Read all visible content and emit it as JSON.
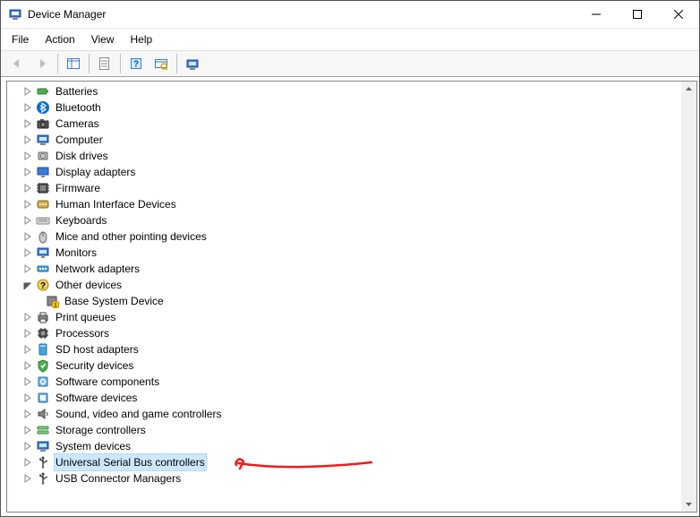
{
  "window": {
    "title": "Device Manager"
  },
  "menu": {
    "file": "File",
    "action": "Action",
    "view": "View",
    "help": "Help"
  },
  "tree": {
    "nodes": [
      {
        "label": "Batteries",
        "icon": "battery",
        "expanded": false,
        "selected": false,
        "depth": 1,
        "hasChildren": true
      },
      {
        "label": "Bluetooth",
        "icon": "bluetooth",
        "expanded": false,
        "selected": false,
        "depth": 1,
        "hasChildren": true
      },
      {
        "label": "Cameras",
        "icon": "camera",
        "expanded": false,
        "selected": false,
        "depth": 1,
        "hasChildren": true
      },
      {
        "label": "Computer",
        "icon": "computer",
        "expanded": false,
        "selected": false,
        "depth": 1,
        "hasChildren": true
      },
      {
        "label": "Disk drives",
        "icon": "disk",
        "expanded": false,
        "selected": false,
        "depth": 1,
        "hasChildren": true
      },
      {
        "label": "Display adapters",
        "icon": "display",
        "expanded": false,
        "selected": false,
        "depth": 1,
        "hasChildren": true
      },
      {
        "label": "Firmware",
        "icon": "firmware",
        "expanded": false,
        "selected": false,
        "depth": 1,
        "hasChildren": true
      },
      {
        "label": "Human Interface Devices",
        "icon": "hid",
        "expanded": false,
        "selected": false,
        "depth": 1,
        "hasChildren": true
      },
      {
        "label": "Keyboards",
        "icon": "keyboard",
        "expanded": false,
        "selected": false,
        "depth": 1,
        "hasChildren": true
      },
      {
        "label": "Mice and other pointing devices",
        "icon": "mouse",
        "expanded": false,
        "selected": false,
        "depth": 1,
        "hasChildren": true
      },
      {
        "label": "Monitors",
        "icon": "monitor",
        "expanded": false,
        "selected": false,
        "depth": 1,
        "hasChildren": true
      },
      {
        "label": "Network adapters",
        "icon": "network",
        "expanded": false,
        "selected": false,
        "depth": 1,
        "hasChildren": true
      },
      {
        "label": "Other devices",
        "icon": "other",
        "expanded": true,
        "selected": false,
        "depth": 1,
        "hasChildren": true
      },
      {
        "label": "Base System Device",
        "icon": "warning",
        "expanded": false,
        "selected": false,
        "depth": 2,
        "hasChildren": false
      },
      {
        "label": "Print queues",
        "icon": "printer",
        "expanded": false,
        "selected": false,
        "depth": 1,
        "hasChildren": true
      },
      {
        "label": "Processors",
        "icon": "cpu",
        "expanded": false,
        "selected": false,
        "depth": 1,
        "hasChildren": true
      },
      {
        "label": "SD host adapters",
        "icon": "sd",
        "expanded": false,
        "selected": false,
        "depth": 1,
        "hasChildren": true
      },
      {
        "label": "Security devices",
        "icon": "security",
        "expanded": false,
        "selected": false,
        "depth": 1,
        "hasChildren": true
      },
      {
        "label": "Software components",
        "icon": "softcomp",
        "expanded": false,
        "selected": false,
        "depth": 1,
        "hasChildren": true
      },
      {
        "label": "Software devices",
        "icon": "softdev",
        "expanded": false,
        "selected": false,
        "depth": 1,
        "hasChildren": true
      },
      {
        "label": "Sound, video and game controllers",
        "icon": "sound",
        "expanded": false,
        "selected": false,
        "depth": 1,
        "hasChildren": true
      },
      {
        "label": "Storage controllers",
        "icon": "storage",
        "expanded": false,
        "selected": false,
        "depth": 1,
        "hasChildren": true
      },
      {
        "label": "System devices",
        "icon": "system",
        "expanded": false,
        "selected": false,
        "depth": 1,
        "hasChildren": true
      },
      {
        "label": "Universal Serial Bus controllers",
        "icon": "usb",
        "expanded": false,
        "selected": true,
        "depth": 1,
        "hasChildren": true
      },
      {
        "label": "USB Connector Managers",
        "icon": "usb",
        "expanded": false,
        "selected": false,
        "depth": 1,
        "hasChildren": true
      }
    ]
  }
}
